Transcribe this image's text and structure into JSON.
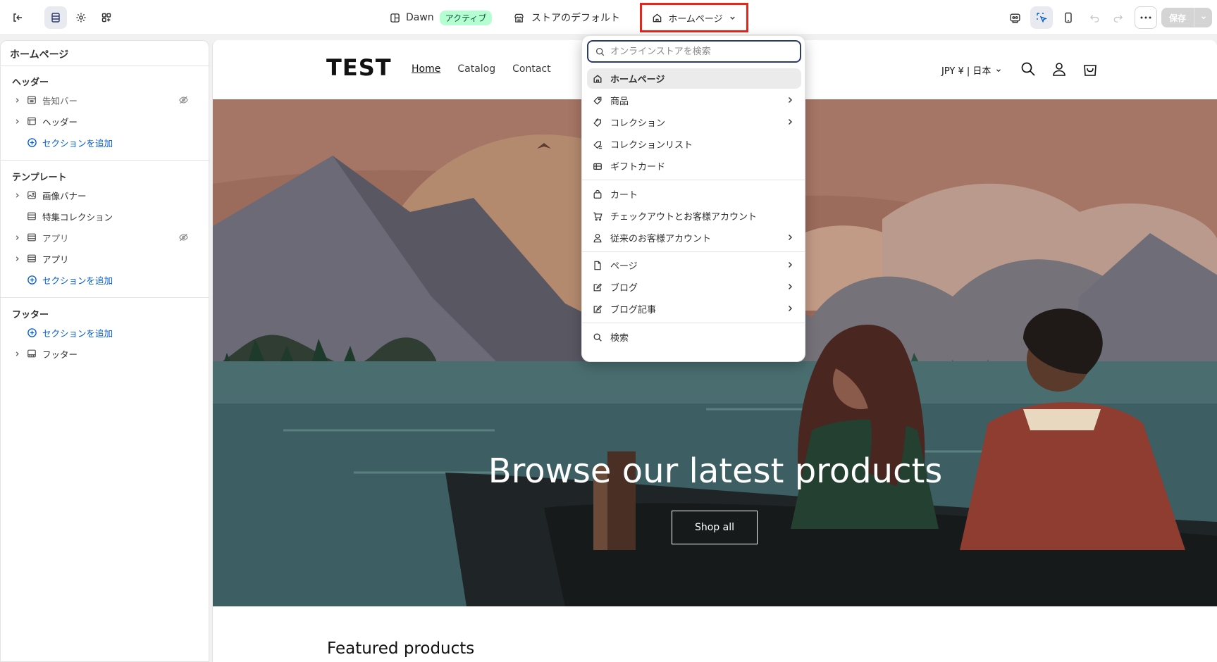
{
  "topbar": {
    "theme_name": "Dawn",
    "theme_badge": "アクティブ",
    "store_default": "ストアのデフォルト",
    "page_selector": "ホームページ",
    "save_label": "保存"
  },
  "sidebar": {
    "title": "ホームページ",
    "groups": [
      {
        "heading": "ヘッダー",
        "items": [
          {
            "label": "告知バー",
            "icon": "announcement-bar-icon",
            "hidden": true
          },
          {
            "label": "ヘッダー",
            "icon": "header-layout-icon",
            "hidden": false
          },
          {
            "label": "セクションを追加",
            "icon": "plus-circle-icon",
            "add": true
          }
        ]
      },
      {
        "heading": "テンプレート",
        "items": [
          {
            "label": "画像バナー",
            "icon": "image-icon",
            "hidden": false
          },
          {
            "label": "特集コレクション",
            "icon": "layout-section-icon",
            "hidden": false
          },
          {
            "label": "アプリ",
            "icon": "layout-section-icon",
            "hidden": true
          },
          {
            "label": "アプリ",
            "icon": "layout-section-icon",
            "hidden": false
          },
          {
            "label": "セクションを追加",
            "icon": "plus-circle-icon",
            "add": true
          }
        ]
      },
      {
        "heading": "フッター",
        "items": [
          {
            "label": "セクションを追加",
            "icon": "plus-circle-icon",
            "add": true
          },
          {
            "label": "フッター",
            "icon": "footer-layout-icon",
            "hidden": false
          }
        ]
      }
    ]
  },
  "dropdown": {
    "search_placeholder": "オンラインストアを検索",
    "items": [
      {
        "label": "ホームページ",
        "icon": "home-icon",
        "selected": true,
        "arrow": false
      },
      {
        "label": "商品",
        "icon": "tag-icon",
        "arrow": true
      },
      {
        "label": "コレクション",
        "icon": "collection-icon",
        "arrow": true
      },
      {
        "label": "コレクションリスト",
        "icon": "collection-list-icon",
        "arrow": false
      },
      {
        "label": "ギフトカード",
        "icon": "gift-card-icon",
        "arrow": false
      },
      {
        "label": "カート",
        "icon": "cart-bag-icon",
        "arrow": false
      },
      {
        "label": "チェックアウトとお客様アカウント",
        "icon": "cart-icon",
        "arrow": false
      },
      {
        "label": "従来のお客様アカウント",
        "icon": "person-icon",
        "arrow": true
      },
      {
        "label": "ページ",
        "icon": "page-icon",
        "arrow": true
      },
      {
        "label": "ブログ",
        "icon": "blog-icon",
        "arrow": true
      },
      {
        "label": "ブログ記事",
        "icon": "blog-post-icon",
        "arrow": true
      },
      {
        "label": "検索",
        "icon": "search-icon",
        "arrow": false
      }
    ]
  },
  "store": {
    "logo": "TEST",
    "nav": [
      "Home",
      "Catalog",
      "Contact"
    ],
    "currency": "JPY ¥ | 日本",
    "hero_title": "Browse our latest products",
    "hero_button": "Shop all",
    "featured_heading": "Featured products"
  },
  "colors": {
    "accent_blue": "#005bd3",
    "highlight_red": "#e5261c",
    "badge_green": "#b4fed2"
  }
}
